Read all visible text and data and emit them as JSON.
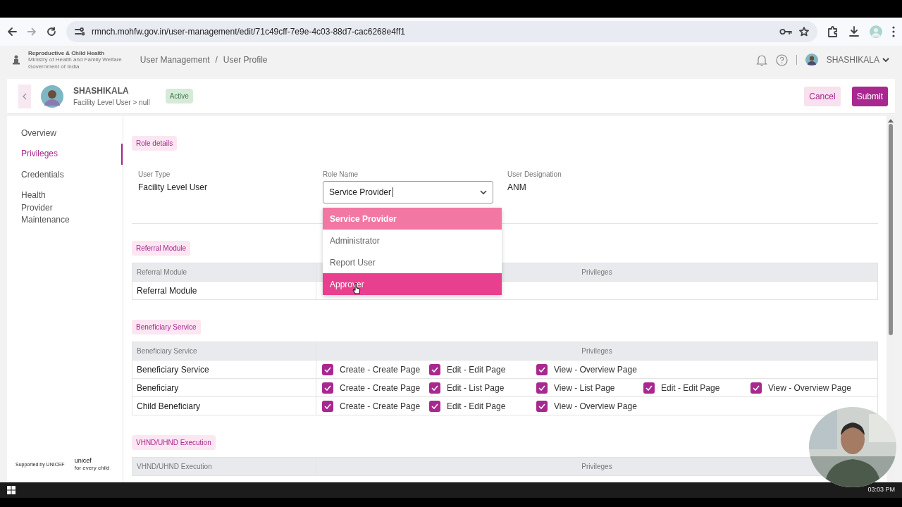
{
  "browser": {
    "url": "rmnch.mohfw.gov.in/user-management/edit/71c49cff-7e9e-4c03-88d7-cac6268e4ff1"
  },
  "header": {
    "org_title": "Reproductive & Child Health",
    "org_subtitle": "Ministry of Health and Family Welfare",
    "org_gov": "Government of India",
    "breadcrumb": [
      "User Management",
      "User Profile"
    ],
    "breadcrumb_separator": "/",
    "user_name": "SHASHIKALA"
  },
  "profile": {
    "name": "SHASHIKALA",
    "subtitle": "Facility Level User > null",
    "status": "Active"
  },
  "actions": [
    {
      "label": "Cancel",
      "kind": "secondary"
    },
    {
      "label": "Submit",
      "kind": "primary"
    }
  ],
  "sidebar": {
    "items": [
      {
        "label": "Overview",
        "selected": false
      },
      {
        "label": "Privileges",
        "selected": true
      },
      {
        "label": "Credentials",
        "selected": false
      },
      {
        "label": "Health Provider Maintenance",
        "selected": false
      }
    ]
  },
  "role_details": {
    "title": "Role details",
    "fields": [
      {
        "label": "User Type",
        "value": "Facility Level User",
        "kind": "text"
      },
      {
        "label": "Role Name",
        "value": "Service Provider",
        "kind": "select"
      },
      {
        "label": "User Designation",
        "value": "ANM",
        "kind": "text"
      }
    ]
  },
  "role_dropdown": {
    "options": [
      {
        "label": "Service Provider",
        "selected": true,
        "hovered": false
      },
      {
        "label": "Administrator",
        "selected": false,
        "hovered": false
      },
      {
        "label": "Report User",
        "selected": false,
        "hovered": false
      },
      {
        "label": "Approver",
        "selected": false,
        "hovered": true
      }
    ]
  },
  "modules": [
    {
      "title": "Referral Module",
      "columns": [
        "Referral Module",
        "Privileges"
      ],
      "rows": [
        {
          "name": "Referral Module"
        }
      ]
    },
    {
      "title": "Beneficiary Service",
      "columns": [
        "Beneficiary Service",
        "Privileges"
      ],
      "rows": [
        {
          "name": "Beneficiary Service",
          "privileges": [
            {
              "label": "Create - Create Page",
              "checked": true
            },
            {
              "label": "Edit - Edit Page",
              "checked": true
            },
            {
              "label": "View - Overview Page",
              "checked": true
            }
          ]
        },
        {
          "name": "Beneficiary",
          "privileges": [
            {
              "label": "Create - Create Page",
              "checked": true
            },
            {
              "label": "Edit - List Page",
              "checked": true
            },
            {
              "label": "View - List Page",
              "checked": true
            },
            {
              "label": "Edit - Edit Page",
              "checked": true
            },
            {
              "label": "View - Overview Page",
              "checked": true
            }
          ]
        },
        {
          "name": "Child Beneficiary",
          "privileges": [
            {
              "label": "Create - Create Page",
              "checked": true
            },
            {
              "label": "Edit - Edit Page",
              "checked": true
            },
            {
              "label": "View - Overview Page",
              "checked": true
            }
          ]
        }
      ]
    },
    {
      "title": "VHND/UHND Execution",
      "columns": [
        "VHND/UHND Execution",
        "Privileges"
      ]
    }
  ],
  "footer": {
    "supported_by": "Supported by UNICEF",
    "unicef": "unicef",
    "tagline": "for every child"
  },
  "taskbar": {
    "time": "03:03 PM"
  }
}
